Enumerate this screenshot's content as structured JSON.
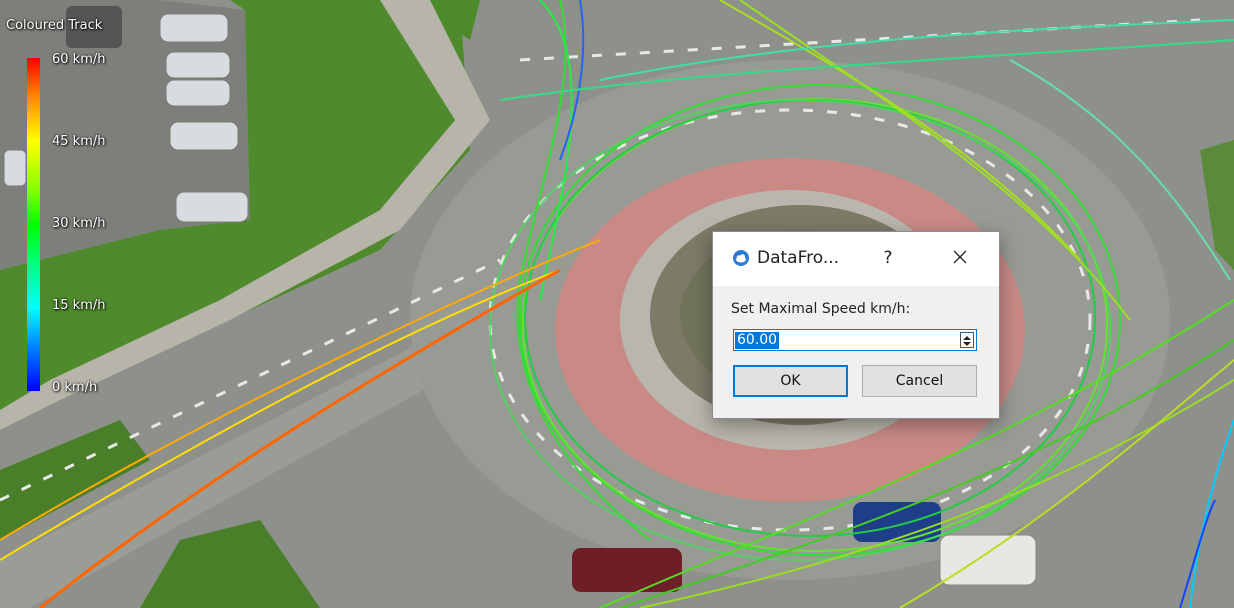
{
  "legend": {
    "title": "Coloured Track",
    "labels": [
      "60 km/h",
      "45 km/h",
      "30 km/h",
      "15 km/h",
      "0 km/h"
    ]
  },
  "dialog": {
    "title": "DataFro...",
    "help": "?",
    "prompt": "Set Maximal Speed km/h:",
    "value": "60.00",
    "ok": "OK",
    "cancel": "Cancel"
  },
  "colors": {
    "accent": "#0078d7",
    "grass": "#4f8a2c",
    "ring": "#c98a86",
    "road": "#8e918b"
  },
  "icons": [
    "app-cloud-icon",
    "close-icon",
    "spin-up-icon",
    "spin-down-icon"
  ]
}
